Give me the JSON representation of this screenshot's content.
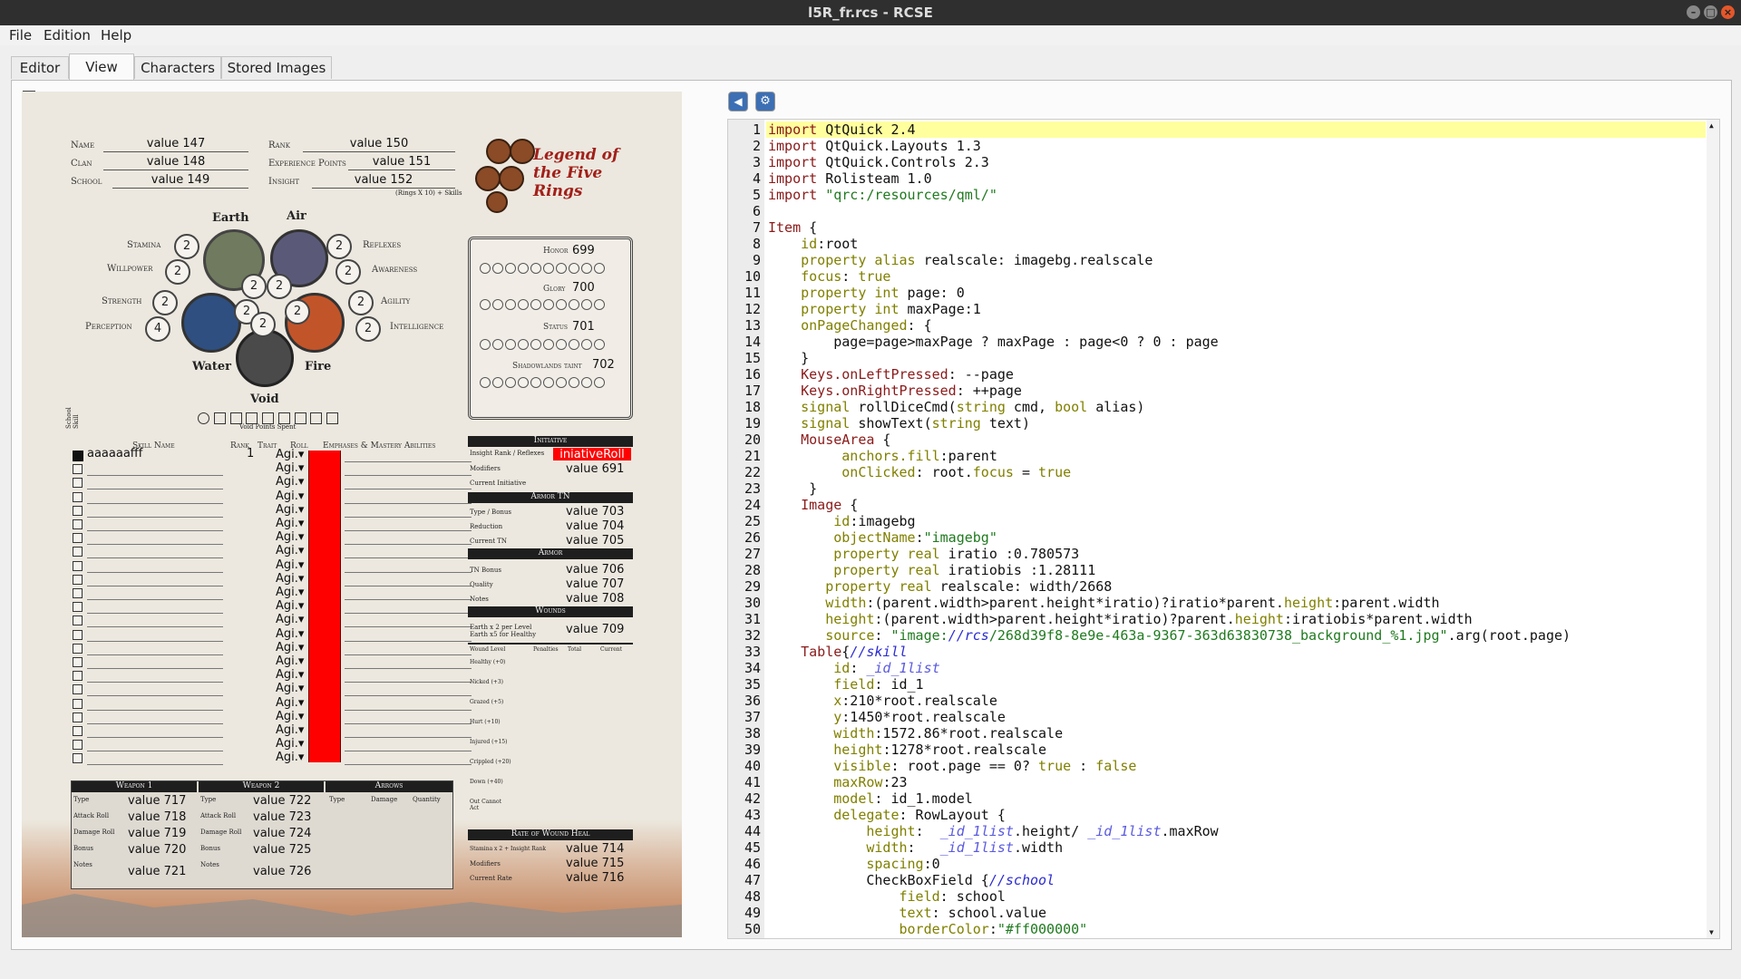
{
  "window": {
    "title": "l5R_fr.rcs - RCSE"
  },
  "menu": [
    "File",
    "Edition",
    "Help"
  ],
  "tabs": [
    "Editor",
    "View",
    "Characters",
    "Stored Images"
  ],
  "sheet": {
    "fields": {
      "name_label": "Name",
      "name_value": "value 147",
      "clan_label": "Clan",
      "clan_value": "value 148",
      "school_label": "School",
      "school_value": "value 149",
      "rank_label": "Rank",
      "rank_value": "value 150",
      "xp_label": "Experience Points",
      "xp_value": "value 151",
      "insight_label": "Insight",
      "insight_value": "value 152",
      "insight_note": "(Rings X 10) + Skills"
    },
    "logo": "Legend of the Five Rings",
    "rings": {
      "earth": "Earth",
      "air": "Air",
      "water": "Water",
      "fire": "Fire",
      "void": "Void",
      "stamina": "Stamina",
      "willpower": "Willpower",
      "reflexes": "Reflexes",
      "awareness": "Awareness",
      "strength": "Strength",
      "perception": "Perception",
      "agility": "Agility",
      "intelligence": "Intelligence",
      "stamina_v": "2",
      "willpower_v": "2",
      "reflexes_v": "2",
      "awareness_v": "2",
      "strength_v": "2",
      "perception_v": "4",
      "agility_v": "2",
      "intelligence_v": "2",
      "earth_v": "2",
      "air_v": "2",
      "water_v": "2",
      "fire_v": "2",
      "void_v": "2",
      "void_spent": "Void Points Spent"
    },
    "honor": {
      "label": "Honor",
      "value": "699"
    },
    "glory": {
      "label": "Glory",
      "value": "700"
    },
    "status": {
      "label": "Status",
      "value": "701"
    },
    "shadow": {
      "label": "Shadowlands taint",
      "value": "702"
    },
    "skills": {
      "school_skill": "School Skill",
      "skill_name": "Skill Name",
      "rank": "Rank",
      "trait": "Trait",
      "roll": "Roll",
      "emphases": "Emphases & Mastery Abilities",
      "first_name": "aaaaaafff",
      "first_rank": "1",
      "trait_value": "Agi."
    },
    "initiative": {
      "title": "Initiative",
      "rank_reflexes": "Insight Rank / Reflexes",
      "roll": "iniativeRoll",
      "modifiers": "Modifiers",
      "modifiers_v": "value 691",
      "current": "Current Initiative"
    },
    "armor_tn": {
      "title": "Armor TN",
      "type": "Type / Bonus",
      "type_v": "value 703",
      "reduction": "Reduction",
      "reduction_v": "value 704",
      "current": "Current TN",
      "current_v": "value 705"
    },
    "armor": {
      "title": "Armor",
      "tn_bonus": "TN Bonus",
      "tn_bonus_v": "value 706",
      "quality": "Quality",
      "quality_v": "value 707",
      "notes": "Notes",
      "notes_v": "value 708"
    },
    "wounds": {
      "title": "Wounds",
      "rule": "Earth x 2 per Level Earth x5 for Healthy",
      "rule_v": "value 709",
      "headers": [
        "Wound Level",
        "Penalties",
        "Total",
        "Current"
      ],
      "levels": [
        "Healthy (+0)",
        "Nicked (+3)",
        "Grazed (+5)",
        "Hurt (+10)",
        "Injured (+15)",
        "Crippled (+20)",
        "Down (+40)",
        "Out Cannot Act"
      ]
    },
    "heal": {
      "title": "Rate of Wound Heal",
      "stamina": "Stamina x 2 + Insight Rank",
      "stamina_v": "value 714",
      "modifiers": "Modifiers",
      "modifiers_v": "value 715",
      "current": "Current Rate",
      "current_v": "value 716"
    },
    "weapon1": {
      "title": "Weapon 1",
      "rows": [
        "Type",
        "Attack Roll",
        "Damage Roll",
        "Bonus",
        "Notes"
      ],
      "values": [
        "value 717",
        "value 718",
        "value 719",
        "value 720",
        "value 721"
      ]
    },
    "weapon2": {
      "title": "Weapon 2",
      "rows": [
        "Type",
        "Attack Roll",
        "Damage Roll",
        "Bonus",
        "Notes"
      ],
      "values": [
        "value 722",
        "value 723",
        "value 724",
        "value 725",
        "value 726"
      ]
    },
    "arrows": {
      "title": "Arrows",
      "headers": [
        "Type",
        "Damage",
        "Quantity"
      ]
    }
  },
  "code_lines": [
    "import QtQuick 2.4",
    "import QtQuick.Layouts 1.3",
    "import QtQuick.Controls 2.3",
    "import Rolisteam 1.0",
    "import \"qrc:/resources/qml/\"",
    "",
    "Item {",
    "    id:root",
    "    property alias realscale: imagebg.realscale",
    "    focus: true",
    "    property int page: 0",
    "    property int maxPage:1",
    "    onPageChanged: {",
    "        page=page>maxPage ? maxPage : page<0 ? 0 : page",
    "    }",
    "    Keys.onLeftPressed: --page",
    "    Keys.onRightPressed: ++page",
    "    signal rollDiceCmd(string cmd, bool alias)",
    "    signal showText(string text)",
    "    MouseArea {",
    "         anchors.fill:parent",
    "         onClicked: root.focus = true",
    "     }",
    "    Image {",
    "        id:imagebg",
    "        objectName:\"imagebg\"",
    "        property real iratio :0.780573",
    "        property real iratiobis :1.28111",
    "       property real realscale: width/2668",
    "       width:(parent.width>parent.height*iratio)?iratio*parent.height:parent.width",
    "       height:(parent.width>parent.height*iratio)?parent.height:iratiobis*parent.width",
    "       source: \"image://rcs/268d39f8-8e9e-463a-9367-363d63830738_background_%1.jpg\".arg(root.page)",
    "    Table{//skill",
    "        id: _id_1list",
    "        field: id_1",
    "        x:210*root.realscale",
    "        y:1450*root.realscale",
    "        width:1572.86*root.realscale",
    "        height:1278*root.realscale",
    "        visible: root.page == 0? true : false",
    "        maxRow:23",
    "        model: id_1.model",
    "        delegate: RowLayout {",
    "            height:  _id_1list.height/ _id_1list.maxRow",
    "            width:   _id_1list.width",
    "            spacing:0",
    "            CheckBoxField {//school",
    "                field: school",
    "                text: school.value",
    "                borderColor:\"#ff000000\""
  ]
}
